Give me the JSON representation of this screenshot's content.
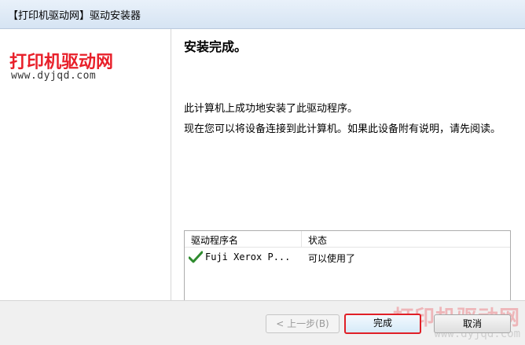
{
  "window": {
    "title": "【打印机驱动网】驱动安装器"
  },
  "logo": {
    "name": "打印机驱动网",
    "url": "www.dyjqd.com"
  },
  "main": {
    "heading": "安装完成。",
    "message1": "此计算机上成功地安装了此驱动程序。",
    "message2": "现在您可以将设备连接到此计算机。如果此设备附有说明，请先阅读。"
  },
  "driver_list": {
    "columns": [
      "驱动程序名",
      "状态"
    ],
    "rows": [
      {
        "icon": "checkmark-icon",
        "name": "Fuji Xerox P...",
        "status": "可以使用了"
      }
    ]
  },
  "buttons": {
    "back": "< 上一步(B)",
    "finish": "完成",
    "cancel": "取消"
  },
  "watermark": {
    "name": "打印机驱动网",
    "url": "www.dyjqd.com"
  },
  "colors": {
    "accent_red": "#e01f26",
    "check_green": "#2e8b2e"
  }
}
